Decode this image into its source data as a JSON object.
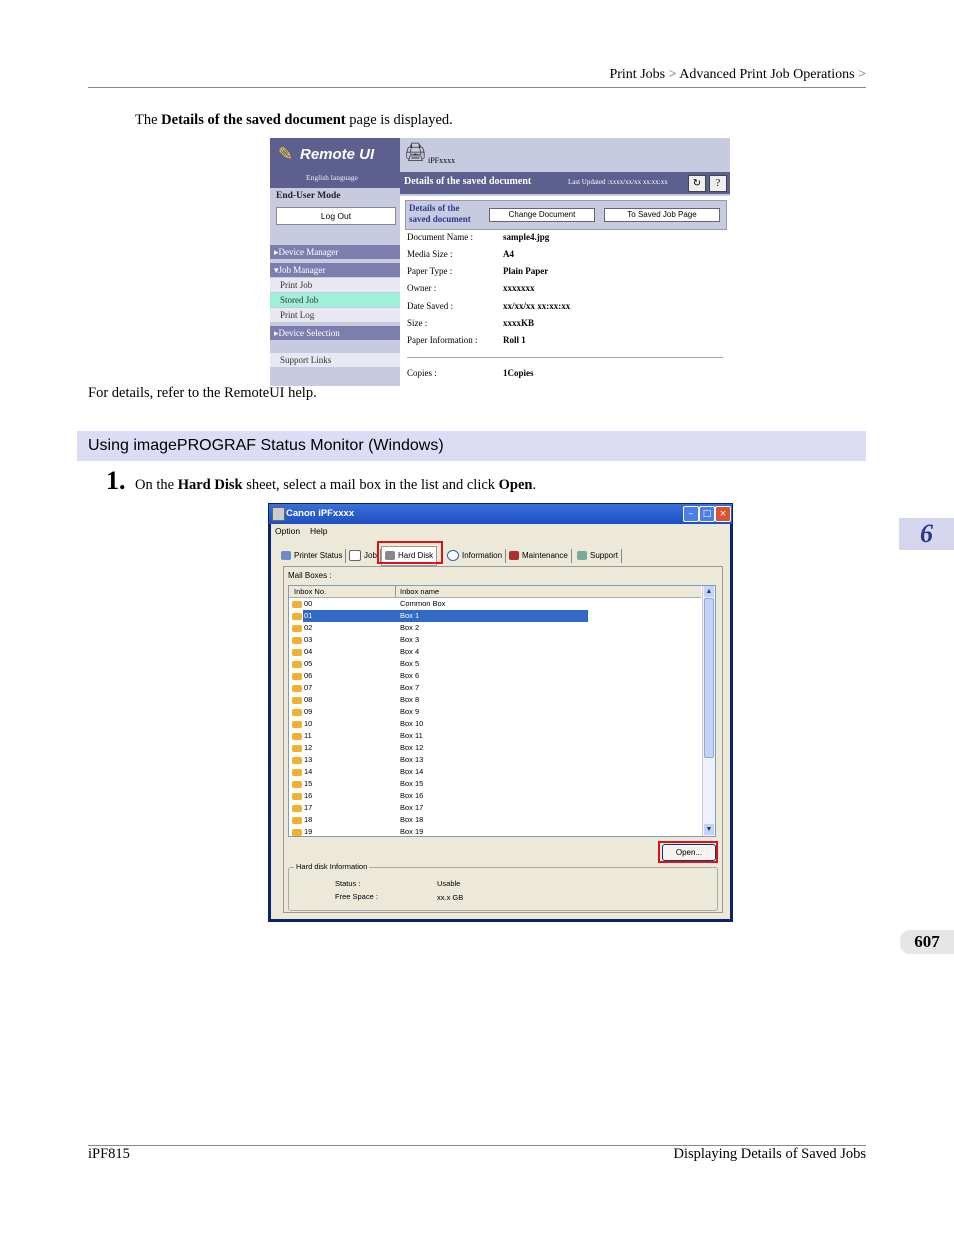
{
  "header": {
    "breadcrumb": [
      "Print Jobs",
      "Advanced Print Job Operations"
    ],
    "breadcrumb_sep": ">"
  },
  "intro": {
    "pre": "The ",
    "bold": "Details of the saved document",
    "post": " page is displayed."
  },
  "remote_ui": {
    "logo": "Remote UI",
    "language": "English language",
    "mode": "End-User Mode",
    "logout": "Log Out",
    "nav": {
      "device_manager": "Device Manager",
      "job_manager": "Job Manager",
      "print_job": "Print Job",
      "stored_job": "Stored Job",
      "print_log": "Print Log",
      "device_selection": "Device Selection",
      "support_links": "Support Links"
    },
    "model": "iPFxxxx",
    "page_title": "Details of the saved document",
    "last_updated": "Last Updated :xxxx/xx/xx xx:xx:xx",
    "refresh_icon": "refresh-icon",
    "help_label": "?",
    "tab_current_line1": "Details of the",
    "tab_current_line2": "saved document",
    "change_document": "Change Document",
    "to_saved_job_page": "To Saved Job Page",
    "fields": [
      {
        "key": "Document Name :",
        "value": "sample4.jpg"
      },
      {
        "key": "Media Size :",
        "value": "A4"
      },
      {
        "key": "Paper Type :",
        "value": "Plain Paper"
      },
      {
        "key": "Owner :",
        "value": "xxxxxxx"
      },
      {
        "key": "Date Saved :",
        "value": "xx/xx/xx xx:xx:xx"
      },
      {
        "key": "Size :",
        "value": "xxxxKB"
      },
      {
        "key": "Paper Information :",
        "value": "Roll 1"
      }
    ],
    "copies": {
      "key": "Copies :",
      "value": "1Copies"
    }
  },
  "details_note": "For details, refer to the RemoteUI help.",
  "section_title": "Using imagePROGRAF Status Monitor (Windows)",
  "step": {
    "number": "1.",
    "parts": [
      {
        "t": "On the ",
        "b": false
      },
      {
        "t": "Hard Disk",
        "b": true
      },
      {
        "t": " sheet, select a mail box in the list and click ",
        "b": false
      },
      {
        "t": "Open",
        "b": true
      },
      {
        "t": ".",
        "b": false
      }
    ]
  },
  "status_monitor": {
    "window_title": "Canon iPFxxxx",
    "menu": [
      "Option",
      "Help"
    ],
    "tabs": [
      "Printer Status",
      "Job",
      "Hard Disk",
      "Information",
      "Maintenance",
      "Support"
    ],
    "selected_tab": "Hard Disk",
    "mail_boxes_label": "Mail Boxes :",
    "col_inbox_no": "Inbox No.",
    "col_inbox_name": "Inbox name",
    "rows": [
      {
        "no": "00",
        "name": "Common Box"
      },
      {
        "no": "01",
        "name": "Box 1"
      },
      {
        "no": "02",
        "name": "Box 2"
      },
      {
        "no": "03",
        "name": "Box 3"
      },
      {
        "no": "04",
        "name": "Box 4"
      },
      {
        "no": "05",
        "name": "Box 5"
      },
      {
        "no": "06",
        "name": "Box 6"
      },
      {
        "no": "07",
        "name": "Box 7"
      },
      {
        "no": "08",
        "name": "Box 8"
      },
      {
        "no": "09",
        "name": "Box 9"
      },
      {
        "no": "10",
        "name": "Box 10"
      },
      {
        "no": "11",
        "name": "Box 11"
      },
      {
        "no": "12",
        "name": "Box 12"
      },
      {
        "no": "13",
        "name": "Box 13"
      },
      {
        "no": "14",
        "name": "Box 14"
      },
      {
        "no": "15",
        "name": "Box 15"
      },
      {
        "no": "16",
        "name": "Box 16"
      },
      {
        "no": "17",
        "name": "Box 17"
      },
      {
        "no": "18",
        "name": "Box 18"
      },
      {
        "no": "19",
        "name": "Box 19"
      }
    ],
    "selected_row": "01",
    "open_button": "Open...",
    "hd_info_label": "Hard disk Information",
    "status_key": "Status :",
    "status_value": "Usable",
    "free_space_key": "Free Space :",
    "free_space_value": "xx.x GB"
  },
  "chapter": "6",
  "page_number": "607",
  "footer": {
    "left": "iPF815",
    "right": "Displaying Details of Saved Jobs"
  },
  "colors": {
    "highlight_box": "#e0101a",
    "section_bar": "#dcdcf4",
    "remote_ui_purple": "#5d5f8f"
  }
}
